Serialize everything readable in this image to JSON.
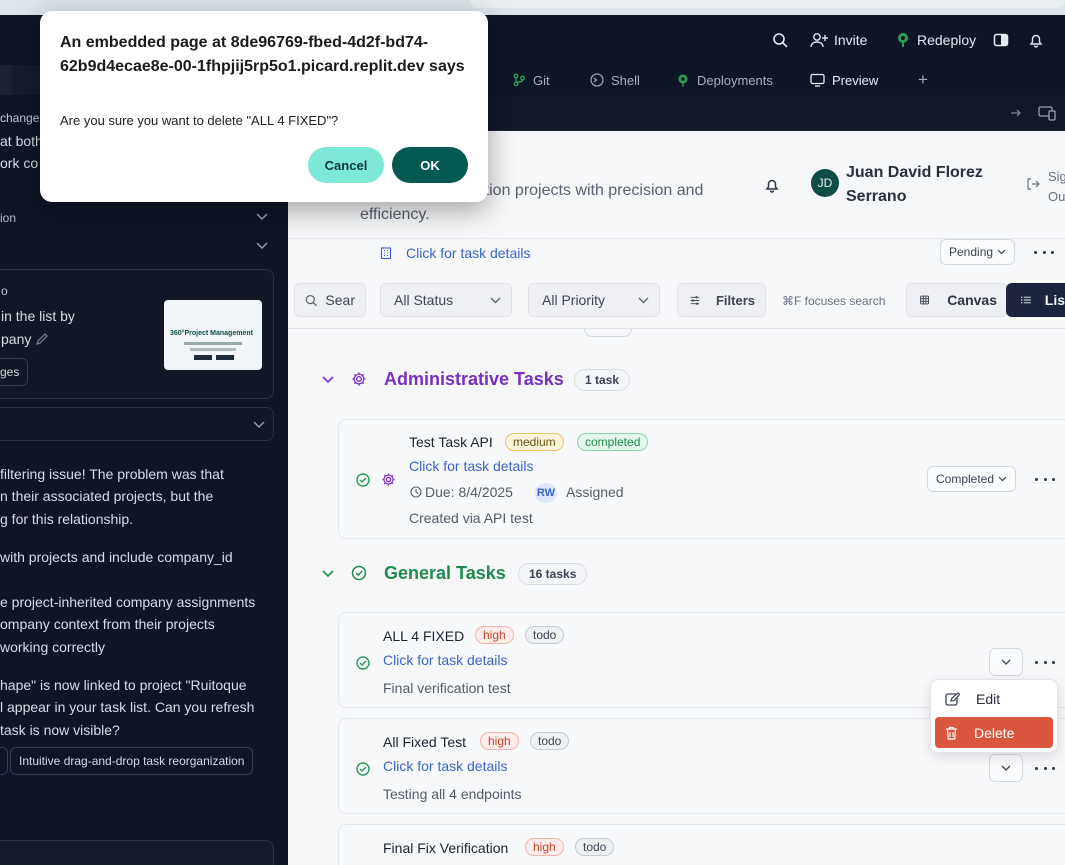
{
  "topbar": {
    "invite_label": "Invite",
    "redeploy_label": "Redeploy"
  },
  "tabs": [
    {
      "label": "Git"
    },
    {
      "label": "Shell"
    },
    {
      "label": "Deployments"
    },
    {
      "label": "Preview"
    }
  ],
  "left_panel": {
    "line_change": "change",
    "line_both": "at both",
    "line_work": "ork co",
    "section_ion": "ion",
    "card_line1": "o",
    "card_line2": "in the list by",
    "card_line3": "pany",
    "card_chip": "ges",
    "thumb_title": "360°Project Management",
    "msg": [
      "filtering issue! The problem was that",
      "n their associated projects, but the",
      "g for this relationship.",
      "with projects and include company_id",
      "e project-inherited company assignments",
      "ompany context from their projects",
      "working correctly",
      "hape\" is now linked to project \"Ruitoque",
      "l appear in your task list. Can you refresh",
      "task is now visible?"
    ],
    "suggestion_chip": "Intuitive drag-and-drop task reorganization"
  },
  "app": {
    "subtitle_line1": "struction projects with precision and",
    "subtitle_line2": "efficiency.",
    "user_initials": "JD",
    "user_name_line1": "Juan David Florez",
    "user_name_line2": "Serrano",
    "signout_line1": "Sig",
    "signout_line2": "Ou",
    "prev_task_link": "Click for task details",
    "prev_task_status": "Pending"
  },
  "filters": {
    "search_placeholder": "Sear",
    "status": "All Status",
    "priority": "All Priority",
    "filters_label": "Filters",
    "shortcut_hint": "⌘F focuses search",
    "canvas_label": "Canvas",
    "list_label": "Lis"
  },
  "groups": [
    {
      "title": "Administrative Tasks",
      "count": "1 task",
      "color": "#7b2fc0",
      "tasks": [
        {
          "title": "Test Task API",
          "priority": "medium",
          "status_badge": "completed",
          "link": "Click for task details",
          "due": "Due: 8/4/2025",
          "assignee_initials": "RW",
          "assigned_label": "Assigned",
          "description": "Created via API test",
          "status_select": "Completed"
        }
      ]
    },
    {
      "title": "General Tasks",
      "count": "16 tasks",
      "color": "#1f8a4c",
      "tasks": [
        {
          "title": "ALL 4 FIXED",
          "priority": "high",
          "status_badge": "todo",
          "link": "Click for task details",
          "description": "Final verification test"
        },
        {
          "title": "All Fixed Test",
          "priority": "high",
          "status_badge": "todo",
          "link": "Click for task details",
          "description": "Testing all 4 endpoints"
        },
        {
          "title": "Final Fix Verification",
          "priority": "high",
          "status_badge": "todo"
        }
      ]
    }
  ],
  "context_menu": {
    "edit_label": "Edit",
    "delete_label": "Delete"
  },
  "dialog": {
    "title": "An embedded page at 8de96769-fbed-4d2f-bd74-62b9d4ecae8e-00-1fhpjij5rp5o1.picard.replit.dev says",
    "message": "Are you sure you want to delete \"ALL 4 FIXED\"?",
    "cancel_label": "Cancel",
    "ok_label": "OK"
  },
  "colors": {
    "dialog_cancel": "#7ee8d6",
    "dialog_ok": "#045a50",
    "delete_item": "#d9573c",
    "link": "#3a64c8",
    "purple": "#7b2fc0",
    "green": "#1f8a4c"
  }
}
